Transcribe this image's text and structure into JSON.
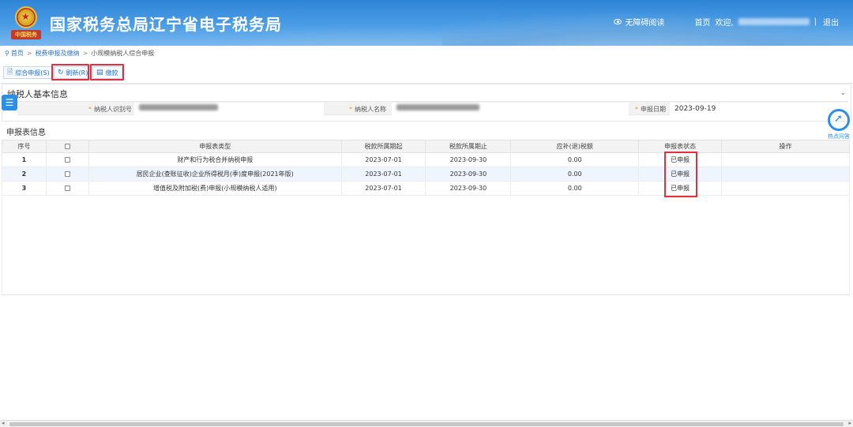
{
  "header": {
    "title": "国家税务总局辽宁省电子税务局",
    "accessibility": "无障碍阅读",
    "home": "首页",
    "welcome": "欢迎,",
    "logout": "退出",
    "emblem_text": "中国税务",
    "divider": "|"
  },
  "breadcrumb": {
    "home": "首页",
    "level2": "税费申报及缴纳",
    "current": "小规模纳税人综合申报",
    "arrow": ">"
  },
  "toolbar": {
    "declare_label": "综合申报(S)",
    "refresh_label": "刷新(R)",
    "pay_label": "缴款"
  },
  "taxpayer": {
    "section_title": "纳税人基本信息",
    "id_label": "纳税人识别号",
    "name_label": "纳税人名称",
    "date_label": "申报日期",
    "date_value": "2023-09-19",
    "required_mark": "*"
  },
  "report": {
    "section_title": "申报表信息",
    "columns": [
      "序号",
      "",
      "申报表类型",
      "税款所属期起",
      "税款所属期止",
      "应补(退)税额",
      "申报表状态",
      "操作"
    ],
    "rows": [
      {
        "no": "1",
        "type": "财产和行为税合并纳税申报",
        "start": "2023-07-01",
        "end": "2023-09-30",
        "amount": "0.00",
        "status": "已申报",
        "op": ""
      },
      {
        "no": "2",
        "type": "居民企业(查账征收)企业所得税月(季)度申报(2021年版)",
        "start": "2023-07-01",
        "end": "2023-09-30",
        "amount": "0.00",
        "status": "已申报",
        "op": ""
      },
      {
        "no": "3",
        "type": "增值税及附加税(费)申报(小规模纳税人适用)",
        "start": "2023-07-01",
        "end": "2023-09-30",
        "amount": "0.00",
        "status": "已申报",
        "op": ""
      }
    ]
  },
  "widgets": {
    "hot_label": "热点问答",
    "menu_glyph": "☰",
    "collapse_glyph": "⌄"
  },
  "icons": {
    "pin": "location-pin-icon",
    "declare": "document-icon",
    "refresh": "refresh-icon",
    "pay": "card-icon",
    "eye": "eye-icon"
  },
  "colors": {
    "header_blue": "#2f84d6",
    "link_blue": "#2b72c8",
    "highlight_red": "#e03040",
    "required_orange": "#f39a1c"
  }
}
